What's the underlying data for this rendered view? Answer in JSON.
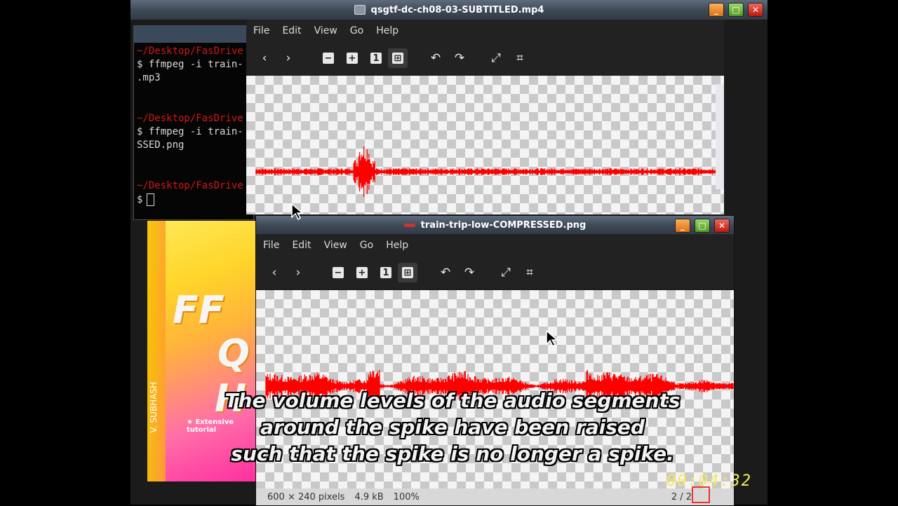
{
  "video_window": {
    "title": "qsgtf-dc-ch08-03-SUBTITLED.mp4",
    "buttons": {
      "minimize": "_",
      "maximize": "□",
      "close": "✕"
    }
  },
  "terminal": {
    "lines": [
      {
        "kind": "path",
        "text": "~/Desktop/FasDrive"
      },
      {
        "kind": "cmd",
        "text": "$ ffmpeg -i train-"
      },
      {
        "kind": "cmd",
        "text": ".mp3"
      },
      {
        "kind": "path",
        "text": "~/Desktop/FasDrive"
      },
      {
        "kind": "cmd",
        "text": "$ ffmpeg -i train-"
      },
      {
        "kind": "cmd",
        "text": "SSED.png"
      },
      {
        "kind": "path",
        "text": "~/Desktop/FasDrive"
      },
      {
        "kind": "cmd",
        "text": "$"
      }
    ]
  },
  "book": {
    "title_letters": [
      "FF",
      "Q",
      "H"
    ],
    "tagline": "★ Extensive tutorial",
    "author": "V. SUBHASH"
  },
  "viewer1": {
    "menu": [
      "File",
      "Edit",
      "View",
      "Go",
      "Help"
    ],
    "toolbar": {
      "prev": "‹",
      "next": "›",
      "zoom_out": "−",
      "zoom_in": "+",
      "actual": "1",
      "fit": "⊞",
      "rotate_left": "↶",
      "rotate_right": "↷",
      "fullscreen": "⤢",
      "slideshow": "⌗"
    }
  },
  "viewer2": {
    "title": "train-trip-low-COMPRESSED.png",
    "menu": [
      "File",
      "Edit",
      "View",
      "Go",
      "Help"
    ],
    "status": {
      "dimensions": "600 × 240 pixels",
      "size": "4.9 kB",
      "zoom": "100%",
      "page": "2 / 2"
    }
  },
  "subtitle": {
    "lines": [
      "The volume levels of the audio segments",
      "around the spike have been raised",
      "such that the spike is no longer a spike."
    ]
  },
  "timecode": "00:04:32",
  "colors": {
    "waveform": "#ff0000",
    "title_gradient_top": "#5d6b7b",
    "terminal_path": "#d01818"
  }
}
